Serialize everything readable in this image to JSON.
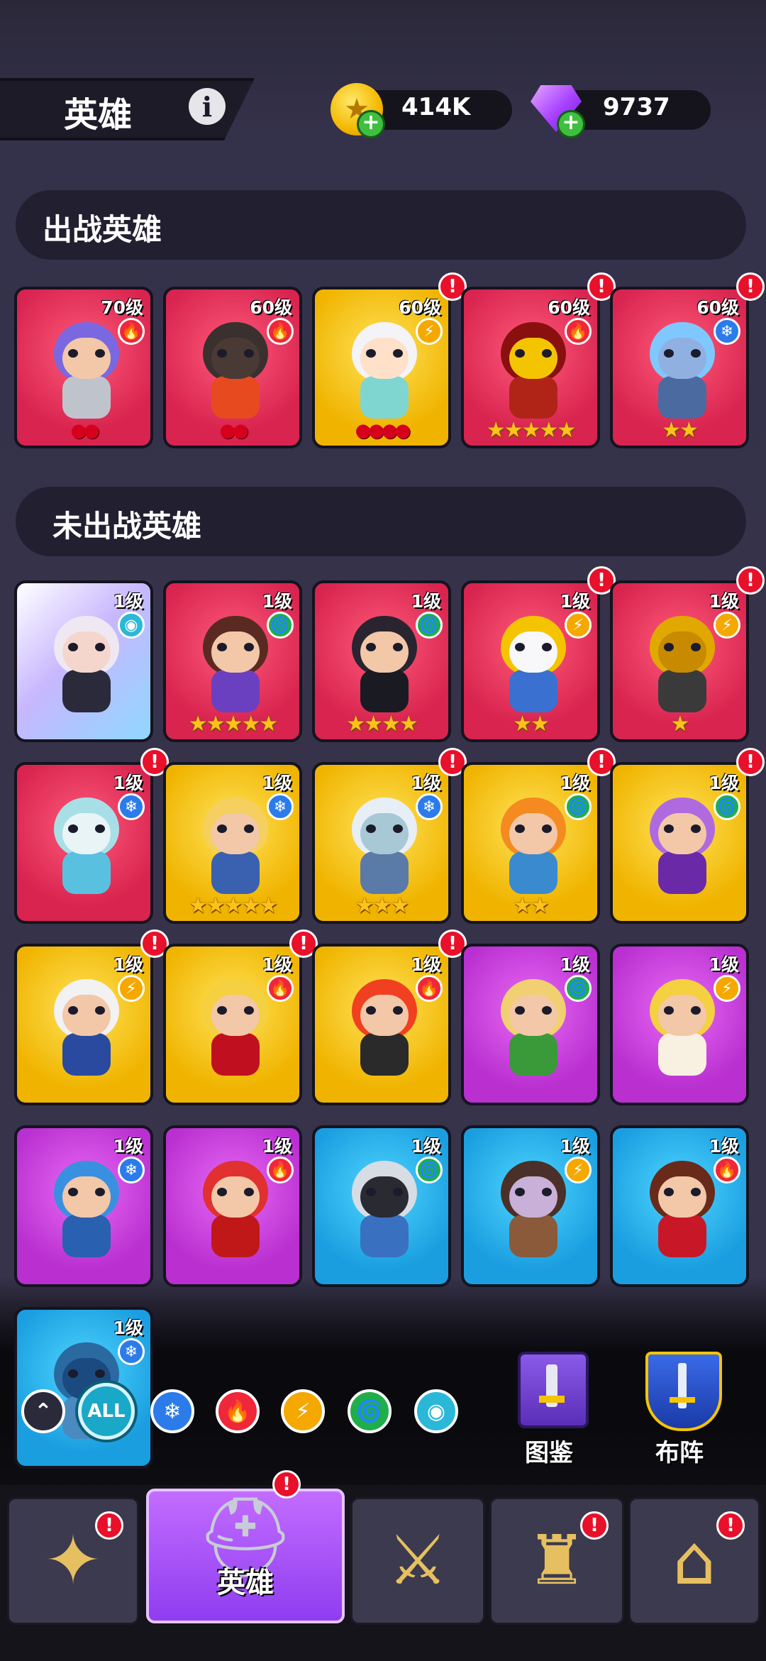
{
  "header": {
    "title": "英雄",
    "info_icon": "info-icon",
    "currencies": [
      {
        "name": "coin",
        "icon": "gold-coin-icon",
        "value": "414K"
      },
      {
        "name": "gem",
        "icon": "purple-gem-icon",
        "value": "9737"
      }
    ]
  },
  "sections": {
    "active_title": "出战英雄",
    "inactive_title": "未出战英雄"
  },
  "active_heroes": [
    {
      "level": "70级",
      "element": "fire",
      "bg": "red",
      "rank": "beads",
      "rank_count": 2,
      "alert": false,
      "palette": [
        "#7a68e0",
        "#f2c8a8",
        "#bfc4cc"
      ]
    },
    {
      "level": "60级",
      "element": "fire",
      "bg": "red",
      "rank": "beads",
      "rank_count": 2,
      "alert": false,
      "palette": [
        "#3a302e",
        "#4a3a36",
        "#e84a20"
      ]
    },
    {
      "level": "60级",
      "element": "lightning",
      "bg": "yellow",
      "rank": "beads",
      "rank_count": 4,
      "alert": true,
      "palette": [
        "#f3f3f8",
        "#ffe0c8",
        "#7fd6d0"
      ]
    },
    {
      "level": "60级",
      "element": "fire",
      "bg": "red",
      "rank": "stars",
      "rank_count": 5,
      "alert": true,
      "palette": [
        "#8a1010",
        "#f5c400",
        "#b02418"
      ]
    },
    {
      "level": "60级",
      "element": "ice",
      "bg": "red",
      "rank": "stars",
      "rank_count": 2,
      "alert": true,
      "palette": [
        "#7fc8ff",
        "#8fb0e0",
        "#4a6aa0"
      ]
    }
  ],
  "inactive_heroes": [
    {
      "level": "1级",
      "element": "mystic",
      "bg": "special",
      "rank": "none",
      "rank_count": 0,
      "alert": false,
      "palette": [
        "#efe8f2",
        "#f5d6cc",
        "#2a2a3a"
      ]
    },
    {
      "level": "1级",
      "element": "wind",
      "bg": "red",
      "rank": "stars",
      "rank_count": 5,
      "alert": false,
      "palette": [
        "#5a2a22",
        "#f2c8a8",
        "#6a40c0"
      ]
    },
    {
      "level": "1级",
      "element": "wind",
      "bg": "red",
      "rank": "stars",
      "rank_count": 4,
      "alert": false,
      "palette": [
        "#2a2430",
        "#f2c8a8",
        "#1a1a22"
      ]
    },
    {
      "level": "1级",
      "element": "lightning",
      "bg": "red",
      "rank": "stars",
      "rank_count": 2,
      "alert": true,
      "palette": [
        "#f5c400",
        "#f8f8fa",
        "#3a70d0"
      ]
    },
    {
      "level": "1级",
      "element": "lightning",
      "bg": "red",
      "rank": "stars",
      "rank_count": 1,
      "alert": true,
      "palette": [
        "#e0a800",
        "#c88a00",
        "#3a3a3a"
      ]
    },
    {
      "level": "1级",
      "element": "ice",
      "bg": "red",
      "rank": "none",
      "rank_count": 0,
      "alert": true,
      "palette": [
        "#a8dfe6",
        "#e8f4f6",
        "#5ac0e0"
      ]
    },
    {
      "level": "1级",
      "element": "ice",
      "bg": "yellow",
      "rank": "stars",
      "rank_count": 5,
      "alert": false,
      "palette": [
        "#f5d060",
        "#f2c8a8",
        "#3a60b0"
      ]
    },
    {
      "level": "1级",
      "element": "ice",
      "bg": "yellow",
      "rank": "stars",
      "rank_count": 3,
      "alert": true,
      "palette": [
        "#e8eef6",
        "#a8c8d6",
        "#5a7aa8"
      ]
    },
    {
      "level": "1级",
      "element": "wind",
      "bg": "yellow",
      "rank": "stars",
      "rank_count": 2,
      "alert": true,
      "palette": [
        "#f58a20",
        "#f2c8a8",
        "#3a8ad0"
      ]
    },
    {
      "level": "1级",
      "element": "wind",
      "bg": "yellow",
      "rank": "none",
      "rank_count": 0,
      "alert": true,
      "palette": [
        "#b06ae0",
        "#f2c8a8",
        "#6a2aa8"
      ]
    },
    {
      "level": "1级",
      "element": "lightning",
      "bg": "yellow",
      "rank": "none",
      "rank_count": 0,
      "alert": true,
      "palette": [
        "#f2f2f2",
        "#f2c8a8",
        "#2a4aa0"
      ]
    },
    {
      "level": "1级",
      "element": "fire",
      "bg": "yellow",
      "rank": "none",
      "rank_count": 0,
      "alert": true,
      "palette": [
        "#f5d040",
        "#f2c8a8",
        "#c01020"
      ]
    },
    {
      "level": "1级",
      "element": "fire",
      "bg": "yellow",
      "rank": "none",
      "rank_count": 0,
      "alert": true,
      "palette": [
        "#f04020",
        "#f2c8a8",
        "#2a2a2a"
      ]
    },
    {
      "level": "1级",
      "element": "wind",
      "bg": "purple",
      "rank": "none",
      "rank_count": 0,
      "alert": false,
      "palette": [
        "#f0d070",
        "#f2c8a8",
        "#3a9a3a"
      ]
    },
    {
      "level": "1级",
      "element": "lightning",
      "bg": "purple",
      "rank": "none",
      "rank_count": 0,
      "alert": false,
      "palette": [
        "#f5d040",
        "#f2c8a8",
        "#f8f0e0"
      ]
    },
    {
      "level": "1级",
      "element": "ice",
      "bg": "purple",
      "rank": "none",
      "rank_count": 0,
      "alert": false,
      "palette": [
        "#3a90e0",
        "#f2c8a8",
        "#2a60b0"
      ]
    },
    {
      "level": "1级",
      "element": "fire",
      "bg": "purple",
      "rank": "none",
      "rank_count": 0,
      "alert": false,
      "palette": [
        "#e03030",
        "#f2c8a8",
        "#c01818"
      ]
    },
    {
      "level": "1级",
      "element": "wind",
      "bg": "blue",
      "rank": "none",
      "rank_count": 0,
      "alert": false,
      "palette": [
        "#d8dce4",
        "#2a2a32",
        "#3a70c0"
      ]
    },
    {
      "level": "1级",
      "element": "lightning",
      "bg": "blue",
      "rank": "none",
      "rank_count": 0,
      "alert": false,
      "palette": [
        "#4a3028",
        "#c8b0d8",
        "#8a5a3a"
      ]
    },
    {
      "level": "1级",
      "element": "fire",
      "bg": "blue",
      "rank": "none",
      "rank_count": 0,
      "alert": false,
      "palette": [
        "#6a2a1a",
        "#f2c8a8",
        "#c81828"
      ]
    },
    {
      "level": "1级",
      "element": "ice",
      "bg": "blue",
      "rank": "none",
      "rank_count": 0,
      "alert": false,
      "palette": [
        "#2a6aa0",
        "#1a4a80",
        "#4a8ac0"
      ]
    }
  ],
  "filters": [
    {
      "name": "collapse",
      "icon": "double-chevron-up-icon",
      "label": "",
      "color": "#2a2a3a"
    },
    {
      "name": "all",
      "icon": "all-icon",
      "label": "ALL",
      "color": "#1aa8c8",
      "selected": true
    },
    {
      "name": "ice",
      "icon": "snowflake-icon",
      "label": "",
      "color": "#2b7bea"
    },
    {
      "name": "fire",
      "icon": "flame-icon",
      "label": "",
      "color": "#f0263a"
    },
    {
      "name": "lightning",
      "icon": "lightning-icon",
      "label": "",
      "color": "#f5a800"
    },
    {
      "name": "wind",
      "icon": "tornado-icon",
      "label": "",
      "color": "#1fae4a"
    },
    {
      "name": "mystic",
      "icon": "eye-icon",
      "label": "",
      "color": "#2bb8d8"
    }
  ],
  "side_buttons": [
    {
      "name": "codex",
      "icon": "book-icon",
      "label": "图鉴"
    },
    {
      "name": "formation",
      "icon": "banner-shield-icon",
      "label": "布阵"
    }
  ],
  "bottom_nav": [
    {
      "name": "cards",
      "icon": "card-icon",
      "label": "",
      "alert": true,
      "active": false
    },
    {
      "name": "heroes",
      "icon": "helmet-icon",
      "label": "英雄",
      "alert": true,
      "active": true
    },
    {
      "name": "battle",
      "icon": "crossed-swords-icon",
      "label": "",
      "alert": false,
      "active": false
    },
    {
      "name": "castle",
      "icon": "castle-icon",
      "label": "",
      "alert": true,
      "active": false
    },
    {
      "name": "shop",
      "icon": "shop-icon",
      "label": "",
      "alert": true,
      "active": false
    }
  ],
  "element_glyphs": {
    "fire": "🔥",
    "lightning": "⚡",
    "ice": "❄",
    "wind": "🌀",
    "mystic": "◉"
  },
  "alert_glyph": "!",
  "star_glyph": "★",
  "bead_glyph": "●"
}
